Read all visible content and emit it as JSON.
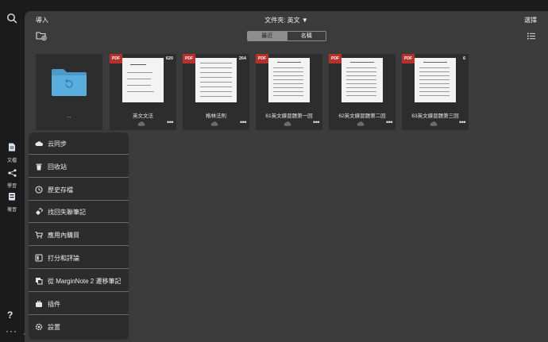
{
  "rail": {
    "docs_label": "文檔",
    "study_label": "學習",
    "review_label": "複習",
    "help": "?",
    "more": "···"
  },
  "topbar": {
    "import": "導入",
    "folder_title": "文件夾: 英文 ▼",
    "select": "選擇"
  },
  "sort_tabs": [
    "最近",
    "名稱"
  ],
  "folder": {
    "name": ".."
  },
  "documents": [
    {
      "name": "英文文法",
      "badge": "PDF",
      "pages": "620"
    },
    {
      "name": "格林法則",
      "badge": "PDF",
      "pages": "264"
    },
    {
      "name": "61英文練習題第一回",
      "badge": "PDF",
      "pages": ""
    },
    {
      "name": "62英文練習題第二回",
      "badge": "PDF",
      "pages": ""
    },
    {
      "name": "63英文練習題第三回",
      "badge": "PDF",
      "pages": "6"
    }
  ],
  "menu": {
    "items": [
      {
        "label": "云同步",
        "icon": "cloud-icon"
      },
      {
        "label": "回收站",
        "icon": "trash-icon"
      },
      {
        "label": "歷史存檔",
        "icon": "history-icon"
      },
      {
        "label": "找回失聯筆記",
        "icon": "recover-icon"
      },
      {
        "label": "應用內購買",
        "icon": "cart-icon"
      },
      {
        "label": "打分和評論",
        "icon": "rate-icon"
      },
      {
        "label": "從 MarginNote 2 遷移筆記",
        "icon": "migrate-icon"
      },
      {
        "label": "插件",
        "icon": "plugin-icon"
      },
      {
        "label": "設置",
        "icon": "settings-icon"
      }
    ]
  },
  "colors": {
    "panel": "#3b3b3b",
    "card": "#2d2d2d",
    "pdf_badge": "#b8302a",
    "folder_blue": "#5aaede",
    "rail_accent": "#cfd8e6"
  }
}
